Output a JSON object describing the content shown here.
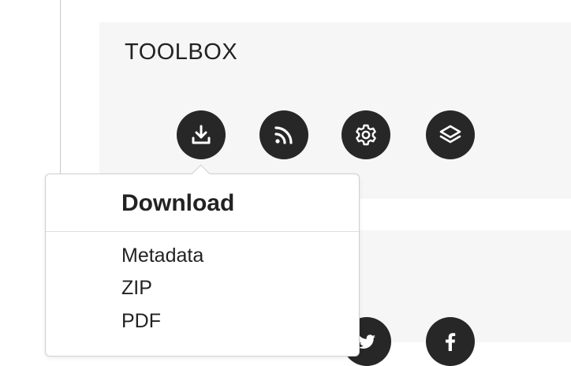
{
  "toolbox": {
    "title": "TOOLBOX",
    "buttons": [
      {
        "icon": "download-icon",
        "action": "Download"
      },
      {
        "icon": "rss-icon",
        "action": "RSS"
      },
      {
        "icon": "gear-icon",
        "action": "Settings"
      },
      {
        "icon": "layers-icon",
        "action": "Layers"
      }
    ]
  },
  "share": {
    "icons": [
      "twitter-icon",
      "facebook-icon"
    ]
  },
  "download_menu": {
    "title": "Download",
    "items": [
      {
        "label": "Metadata"
      },
      {
        "label": "ZIP"
      },
      {
        "label": "PDF"
      }
    ]
  },
  "colors": {
    "icon_button_bg": "#272727",
    "panel_bg": "#f6f6f6",
    "popover_border": "#d0d0d0"
  }
}
